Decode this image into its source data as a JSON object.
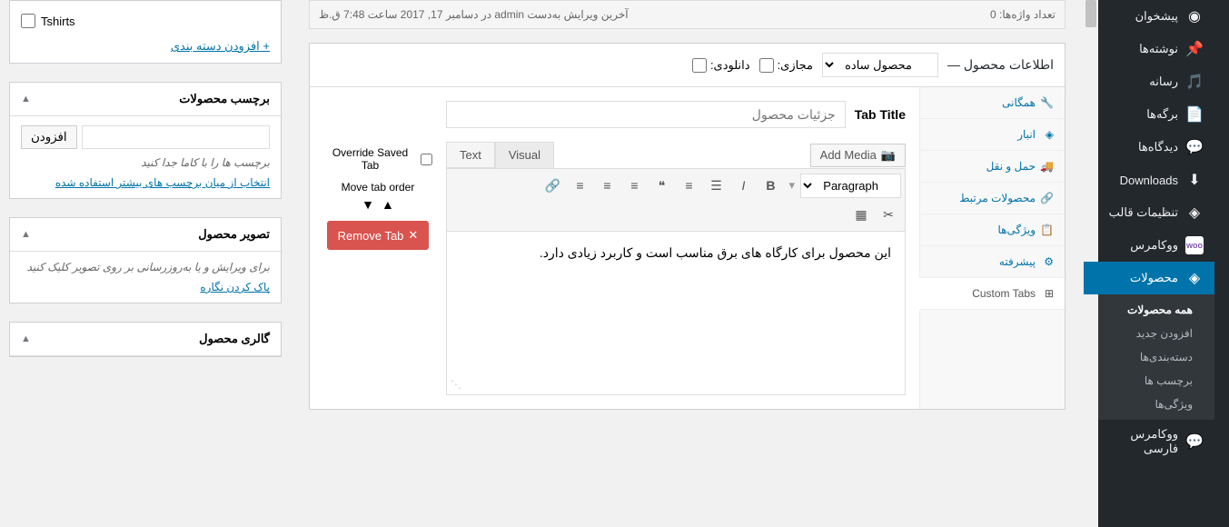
{
  "sidebar": {
    "items": [
      {
        "label": "پیشخوان",
        "icon": "⚙"
      },
      {
        "label": "نوشته‌ها",
        "icon": "📌"
      },
      {
        "label": "رسانه",
        "icon": "🖼"
      },
      {
        "label": "برگه‌ها",
        "icon": "📄"
      },
      {
        "label": "دیدگاه‌ها",
        "icon": "💬"
      },
      {
        "label": "Downloads",
        "icon": "⬇"
      },
      {
        "label": "تنظیمات قالب",
        "icon": "◈"
      },
      {
        "label": "ووکامرس",
        "icon": "woo"
      },
      {
        "label": "محصولات",
        "icon": "📦"
      }
    ],
    "submenu": [
      {
        "label": "همه محصولات"
      },
      {
        "label": "افزودن جدید"
      },
      {
        "label": "دسته‌بندی‌ها"
      },
      {
        "label": "برچسب ها"
      },
      {
        "label": "ویژگی‌ها"
      }
    ],
    "footer_item": {
      "label": "ووکامرس فارسی",
      "icon": "💬"
    }
  },
  "editor_footer": {
    "word_count": "تعداد واژه‌ها: 0",
    "last_edit": "آخرین ویرایش به‌دست admin در دسامبر 17, 2017 ساعت 7:48 ق.ظ"
  },
  "product_data": {
    "title": "اطلاعات محصول —",
    "type_options": [
      "محصول ساده"
    ],
    "virtual_label": "مجازی:",
    "downloadable_label": "دانلودی:",
    "tabs": [
      {
        "label": "همگانی",
        "icon": "🔧"
      },
      {
        "label": "انبار",
        "icon": "◈"
      },
      {
        "label": "حمل و نقل",
        "icon": "🚚"
      },
      {
        "label": "محصولات مرتبط",
        "icon": "🔗"
      },
      {
        "label": "ویژگی‌ها",
        "icon": "📋"
      },
      {
        "label": "پیشرفته",
        "icon": "⚙"
      },
      {
        "label": "Custom Tabs",
        "icon": "⊞"
      }
    ]
  },
  "custom_tab": {
    "title_label": "Tab Title",
    "title_placeholder": "جزئیات محصول",
    "add_media": "Add Media",
    "visual_tab": "Visual",
    "text_tab": "Text",
    "paragraph": "Paragraph",
    "content": "این محصول برای کارگاه های برق مناسب است و کاربرد زیادی دارد.",
    "override_label": "Override Saved Tab",
    "move_label": "Move tab order",
    "remove_label": "Remove Tab"
  },
  "sidebar_boxes": {
    "tshirts_label": "Tshirts",
    "add_category": "+ افزودن دسته بندی",
    "tags_title": "برچسب محصولات",
    "tags_add_btn": "افزودن",
    "tags_hint": "برچسب ها را با کاما جدا کنید",
    "tags_choose": "انتخاب از میان برچسب های بیشتر استفاده شده",
    "image_title": "تصویر محصول",
    "image_hint": "برای ویرایش و یا به‌روزرسانی بر روی تصویر کلیک کنید",
    "image_remove": "پاک کردن نگاره",
    "gallery_title": "گالری محصول"
  }
}
